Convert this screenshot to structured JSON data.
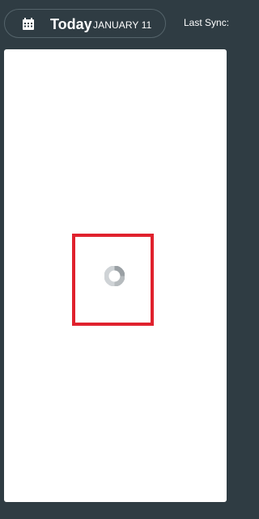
{
  "header": {
    "today_label": "Today",
    "date_label": "JANUARY 11",
    "sync_label": "Last Sync:",
    "calendar_icon": "calendar-icon"
  },
  "content": {
    "loading_icon": "loading-spinner-icon",
    "highlight_color": "#e0212d"
  },
  "colors": {
    "background": "#2f3c43",
    "panel": "#ffffff",
    "text": "#ffffff"
  }
}
